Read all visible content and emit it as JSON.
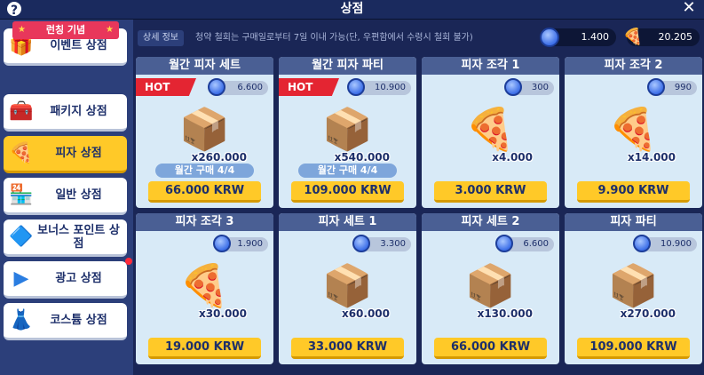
{
  "header": {
    "title": "상점",
    "help_icon": "?",
    "close_icon": "✕"
  },
  "sidebar": {
    "ribbon": "런칭 기념",
    "items": [
      {
        "label": "이벤트 상점",
        "icon": "🎁"
      },
      {
        "label": "패키지 상점",
        "icon": "🧰"
      },
      {
        "label": "피자 상점",
        "icon": "🍕"
      },
      {
        "label": "일반 상점",
        "icon": "🏪"
      },
      {
        "label": "보너스 포인트 상점",
        "icon": "🔷"
      },
      {
        "label": "광고 상점",
        "icon": "▶"
      },
      {
        "label": "코스튬 상점",
        "icon": "👗"
      }
    ]
  },
  "infobar": {
    "tag": "상세 정보",
    "text": "청약 철회는 구매일로부터 7일 이내 가능(단, 우편함에서 수령시 철회 불가)",
    "gems": "1.400",
    "pizza": "20.205"
  },
  "products": [
    {
      "name": "월간 피자 세트",
      "hot": "HOT",
      "price": "6.600",
      "qty": "x260.000",
      "limit": "월간 구매 4/4",
      "buy": "66.000 KRW",
      "icon": "📦"
    },
    {
      "name": "월간 피자 파티",
      "hot": "HOT",
      "price": "10.900",
      "qty": "x540.000",
      "limit": "월간 구매 4/4",
      "buy": "109.000 KRW",
      "icon": "📦"
    },
    {
      "name": "피자 조각 1",
      "hot": "",
      "price": "300",
      "qty": "x4.000",
      "limit": "",
      "buy": "3.000 KRW",
      "icon": "🍕"
    },
    {
      "name": "피자 조각 2",
      "hot": "",
      "price": "990",
      "qty": "x14.000",
      "limit": "",
      "buy": "9.900 KRW",
      "icon": "🍕"
    },
    {
      "name": "피자 조각 3",
      "hot": "",
      "price": "1.900",
      "qty": "x30.000",
      "limit": "",
      "buy": "19.000 KRW",
      "icon": "🍕"
    },
    {
      "name": "피자 세트 1",
      "hot": "",
      "price": "3.300",
      "qty": "x60.000",
      "limit": "",
      "buy": "33.000 KRW",
      "icon": "📦"
    },
    {
      "name": "피자 세트 2",
      "hot": "",
      "price": "6.600",
      "qty": "x130.000",
      "limit": "",
      "buy": "66.000 KRW",
      "icon": "📦"
    },
    {
      "name": "피자 파티",
      "hot": "",
      "price": "10.900",
      "qty": "x270.000",
      "limit": "",
      "buy": "109.000 KRW",
      "icon": "📦"
    }
  ]
}
